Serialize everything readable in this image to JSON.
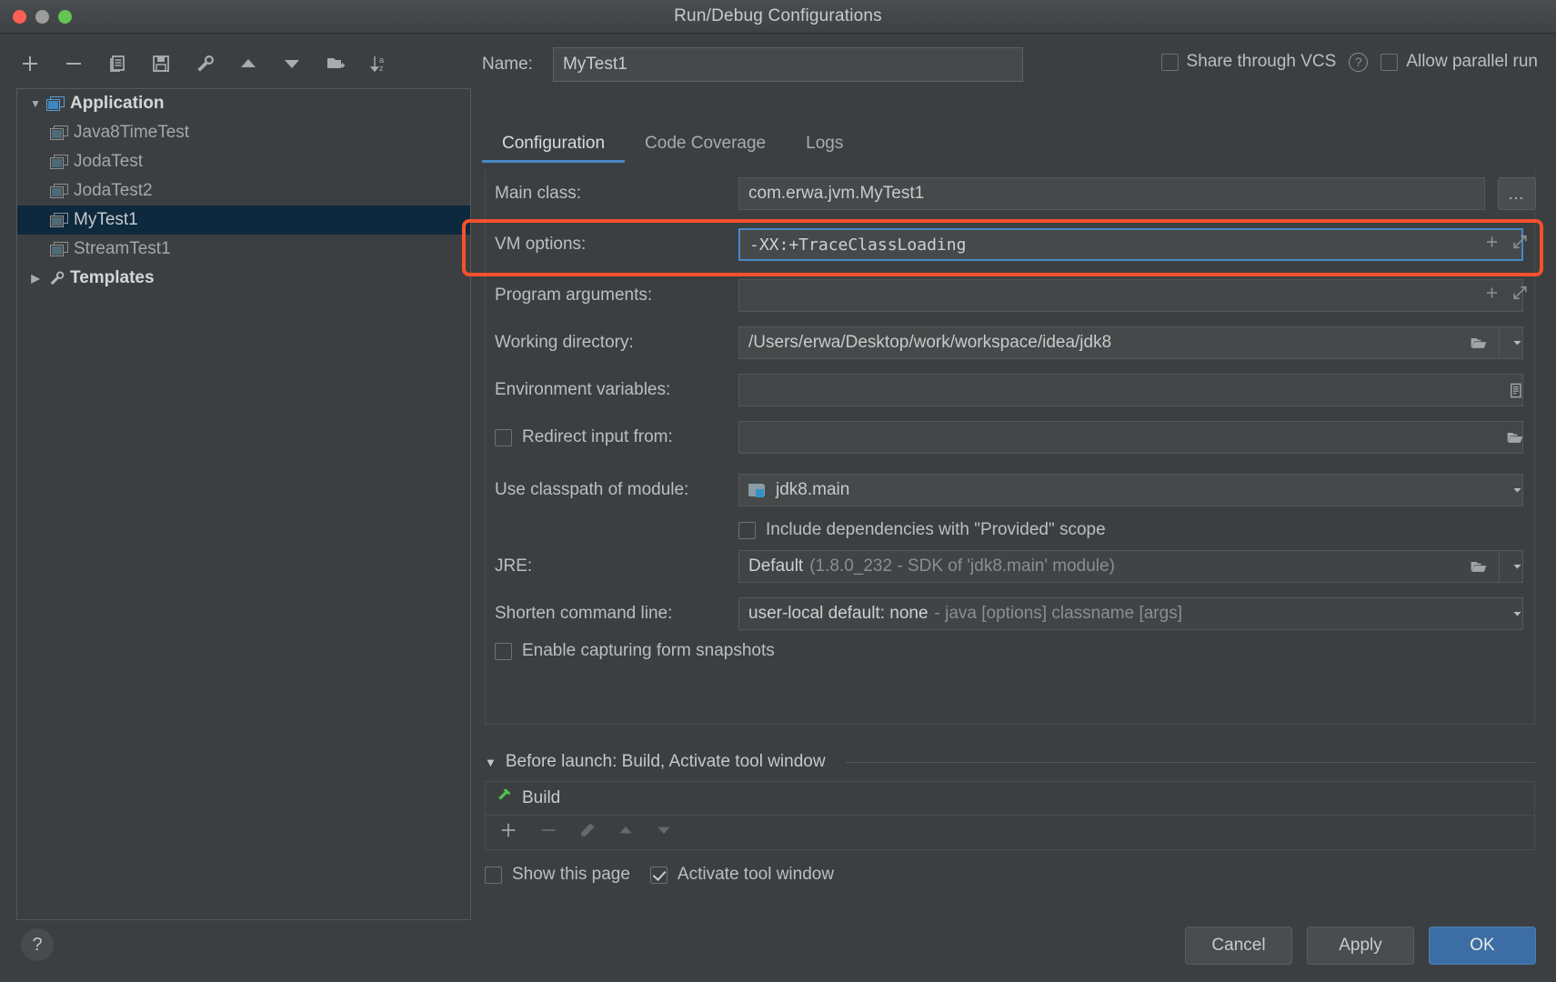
{
  "window": {
    "title": "Run/Debug Configurations",
    "traffic_lights": [
      "close",
      "minimize",
      "zoom"
    ]
  },
  "left_toolbar": {
    "icons": [
      {
        "name": "add-icon",
        "glyph": "+"
      },
      {
        "name": "remove-icon",
        "glyph": "−"
      },
      {
        "name": "copy-icon",
        "glyph": "copy"
      },
      {
        "name": "save-icon",
        "glyph": "save"
      },
      {
        "name": "edit-templates-icon",
        "glyph": "wrench"
      },
      {
        "name": "move-up-icon",
        "glyph": "▲"
      },
      {
        "name": "move-down-icon",
        "glyph": "▼"
      },
      {
        "name": "new-folder-icon",
        "glyph": "folder-plus"
      },
      {
        "name": "sort-alphabetically-icon",
        "glyph": "sort-az"
      }
    ]
  },
  "tree": {
    "nodes": [
      {
        "label": "Application",
        "type": "group",
        "expanded": true,
        "selected": false,
        "icon": "application-icon"
      },
      {
        "label": "Java8TimeTest",
        "type": "config",
        "selected": false,
        "icon": "configuration-icon"
      },
      {
        "label": "JodaTest",
        "type": "config",
        "selected": false,
        "icon": "configuration-icon"
      },
      {
        "label": "JodaTest2",
        "type": "config",
        "selected": false,
        "icon": "configuration-icon"
      },
      {
        "label": "MyTest1",
        "type": "config",
        "selected": true,
        "icon": "configuration-icon"
      },
      {
        "label": "StreamTest1",
        "type": "config",
        "selected": false,
        "icon": "configuration-icon"
      },
      {
        "label": "Templates",
        "type": "group",
        "expanded": false,
        "selected": false,
        "icon": "wrench-icon"
      }
    ]
  },
  "header": {
    "name_label": "Name:",
    "name_value": "MyTest1",
    "share_vcs_label": "Share through VCS",
    "share_vcs_checked": false,
    "share_vcs_help": "?",
    "allow_parallel_label": "Allow parallel run",
    "allow_parallel_checked": false
  },
  "tabs": [
    {
      "label": "Configuration",
      "active": true
    },
    {
      "label": "Code Coverage",
      "active": false
    },
    {
      "label": "Logs",
      "active": false
    }
  ],
  "form": {
    "main_class": {
      "label": "Main class:",
      "value": "com.erwa.jvm.MyTest1",
      "browse": "…"
    },
    "vm_options": {
      "label": "VM options:",
      "value": "-XX:+TraceClassLoading",
      "focused": true,
      "insert_icon": "+",
      "expand_icon": "expand"
    },
    "program_arguments": {
      "label": "Program arguments:",
      "value": "",
      "insert_icon": "+",
      "expand_icon": "expand"
    },
    "working_directory": {
      "label": "Working directory:",
      "value": "/Users/erwa/Desktop/work/workspace/idea/jdk8"
    },
    "environment_variables": {
      "label": "Environment variables:",
      "value": ""
    },
    "redirect_input": {
      "label": "Redirect input from:",
      "checked": false,
      "value": ""
    },
    "use_classpath": {
      "label": "Use classpath of module:",
      "value": "jdk8.main"
    },
    "include_provided": {
      "label": "Include dependencies with \"Provided\" scope",
      "checked": false
    },
    "jre": {
      "label": "JRE:",
      "value_strong": "Default",
      "value_dim": "(1.8.0_232 - SDK of 'jdk8.main' module)"
    },
    "shorten_command_line": {
      "label": "Shorten command line:",
      "value_strong": "user-local default: none",
      "value_dim": "- java [options] classname [args]"
    },
    "enable_capturing": {
      "label": "Enable capturing form snapshots",
      "checked": false
    }
  },
  "before_launch": {
    "header": "Before launch: Build, Activate tool window",
    "items": [
      {
        "label": "Build",
        "icon": "build-hammer-icon"
      }
    ],
    "toolbar": [
      {
        "name": "add-task-icon",
        "glyph": "+",
        "enabled": true
      },
      {
        "name": "remove-task-icon",
        "glyph": "−",
        "enabled": false
      },
      {
        "name": "edit-task-icon",
        "glyph": "pencil",
        "enabled": false
      },
      {
        "name": "move-task-up-icon",
        "glyph": "▲",
        "enabled": false
      },
      {
        "name": "move-task-down-icon",
        "glyph": "▼",
        "enabled": false
      }
    ],
    "show_this_page": {
      "label": "Show this page",
      "checked": false
    },
    "activate_tool_window": {
      "label": "Activate tool window",
      "checked": true
    }
  },
  "footer": {
    "help_label": "?",
    "cancel_label": "Cancel",
    "apply_label": "Apply",
    "ok_label": "OK"
  },
  "annotation": {
    "highlight_color": "#f4512c",
    "target": "vm-options-row"
  },
  "colors": {
    "background": "#3c3f41",
    "accent": "#4a88c7",
    "selection": "#0d293e",
    "primary_button": "#3c6ea5",
    "highlight": "#f4512c"
  }
}
